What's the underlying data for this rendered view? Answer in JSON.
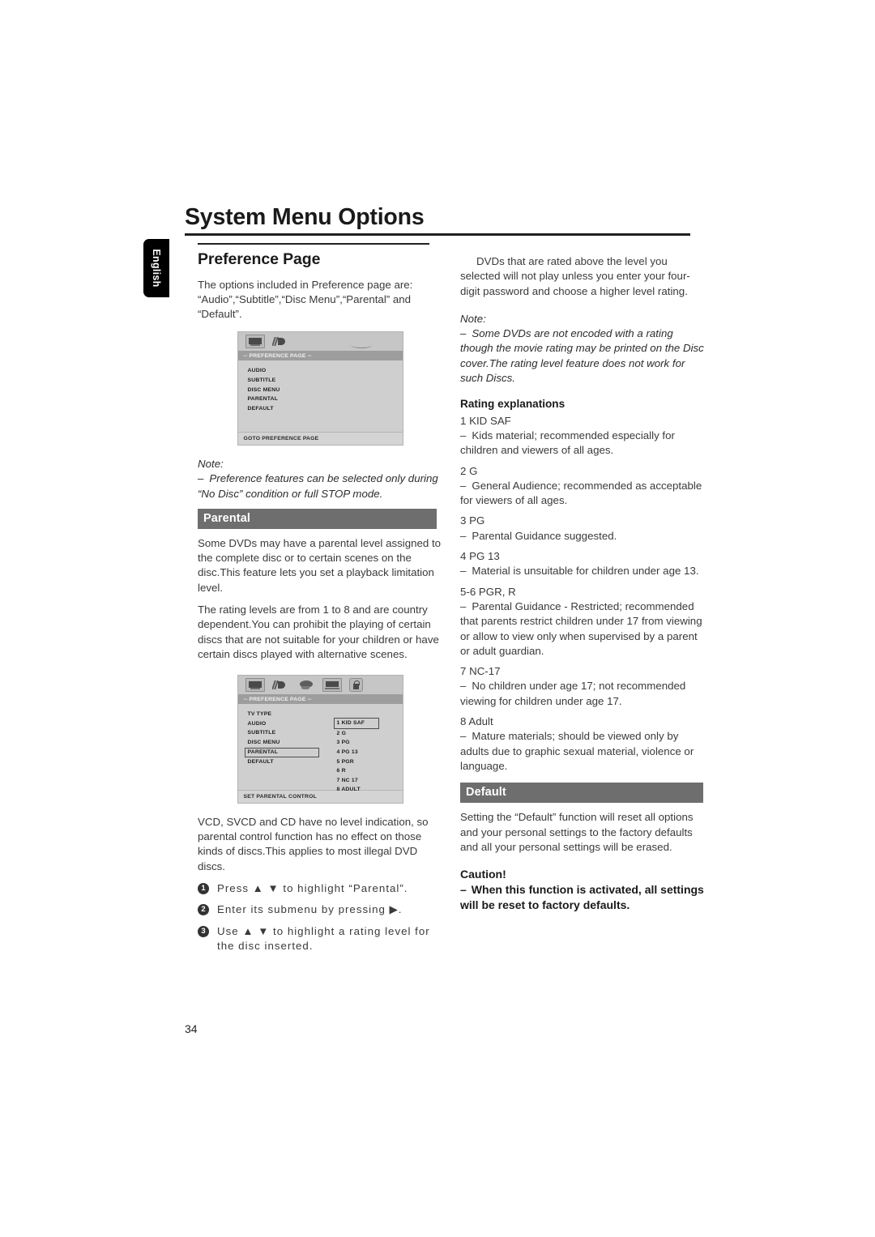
{
  "document": {
    "title": "System Menu Options",
    "language_tab": "English",
    "page_number": "34"
  },
  "left_column": {
    "section_title": "Preference Page",
    "intro": "The options included in Preference page are: “Audio”,“Subtitle”,“Disc Menu”,“Parental” and “Default”.",
    "note_label": "Note:",
    "note_dash": "–",
    "note_text": "Preference features can be selected only during “No Disc” condition or full STOP mode.",
    "parental_heading": "Parental",
    "parental_p1": "Some DVDs may have a parental level assigned to the complete disc or to certain scenes on the disc.This feature lets you set a playback limitation level.",
    "parental_p2": "The rating levels are from 1 to 8 and are country dependent.You can prohibit the playing of certain discs that are not suitable for your children or have certain discs played with alternative scenes.",
    "parental_p3": "VCD, SVCD and CD have no level indication, so parental control function has no effect on those kinds of discs.This applies to most illegal DVD discs.",
    "steps": [
      {
        "num": "1",
        "text": "Press ▲ ▼ to highlight “Parental”."
      },
      {
        "num": "2",
        "text": "Enter its submenu by pressing ▶."
      },
      {
        "num": "3",
        "text": "Use ▲ ▼ to highlight a rating level for the disc inserted."
      }
    ]
  },
  "osd_preference": {
    "title_bar": "-- PREFERENCE PAGE --",
    "icons": [
      "tv-type-icon",
      "audio-icon"
    ],
    "menu_items": [
      "AUDIO",
      "SUBTITLE",
      "DISC MENU",
      "PARENTAL",
      "DEFAULT"
    ],
    "footer": "GOTO PREFERENCE PAGE"
  },
  "osd_parental": {
    "title_bar": "-- PREFERENCE PAGE --",
    "icons": [
      "tv-type-icon",
      "audio-icon",
      "subtitle-icon",
      "disc-menu-icon",
      "parental-lock-icon"
    ],
    "menu_items": [
      "TV TYPE",
      "AUDIO",
      "SUBTITLE",
      "DISC MENU",
      "PARENTAL",
      "DEFAULT"
    ],
    "highlighted_menu_item": "PARENTAL",
    "rating_levels": [
      "1 KID SAF",
      "2 G",
      "3 PG",
      "4 PG 13",
      "5 PGR",
      "6 R",
      "7 NC 17",
      "8 ADULT"
    ],
    "highlighted_rating": "1 KID SAF",
    "footer": "SET PARENTAL CONTROL"
  },
  "right_column": {
    "intro": "DVDs that are rated above the level you selected will not play unless you enter your four-digit password and choose a higher level rating.",
    "note_label": "Note:",
    "note_dash": "–",
    "note_text": "Some DVDs are not encoded with a rating though the movie rating may be printed on the Disc cover.The rating level feature does not work for such Discs.",
    "rating_explanations_heading": "Rating explanations",
    "dash": "–",
    "ratings": [
      {
        "name": "1 KID SAF",
        "desc": "Kids material; recommended especially for children and viewers of all ages."
      },
      {
        "name": "2 G",
        "desc": "General Audience; recommended as acceptable for viewers of all ages."
      },
      {
        "name": "3 PG",
        "desc": "Parental Guidance suggested."
      },
      {
        "name": "4 PG 13",
        "desc": "Material is unsuitable for children under age 13."
      },
      {
        "name": "5-6 PGR, R",
        "desc": "Parental Guidance - Restricted; recommended that parents restrict children under 17 from viewing or allow to view only when supervised by a parent or adult guardian."
      },
      {
        "name": "7 NC-17",
        "desc": "No children under age 17; not recommended viewing for children under age 17."
      },
      {
        "name": "8 Adult",
        "desc": "Mature materials; should be viewed only by adults due to graphic sexual material, violence or language."
      }
    ],
    "default_heading": "Default",
    "default_text": "Setting the “Default” function will reset all options and your personal settings to the factory defaults and all your personal settings will be erased.",
    "caution_title": "Caution!",
    "caution_dash": "–",
    "caution_text": "When this function is activated, all settings will be reset to factory defaults."
  }
}
